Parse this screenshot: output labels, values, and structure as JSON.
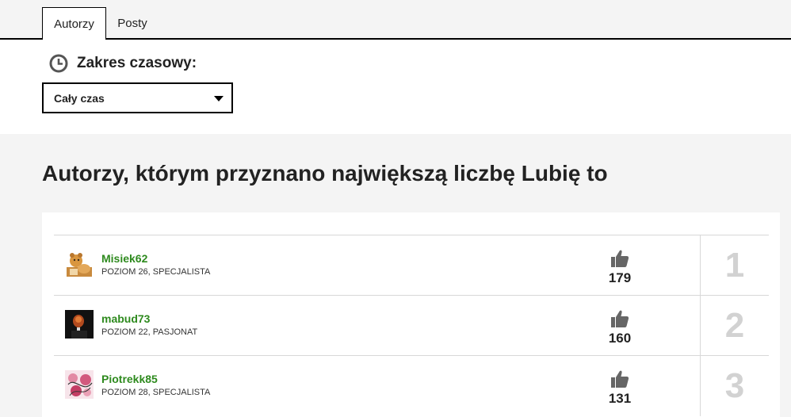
{
  "tabs": [
    {
      "label": "Autorzy",
      "active": true
    },
    {
      "label": "Posty",
      "active": false
    }
  ],
  "time_range": {
    "title": "Zakres czasowy:",
    "selected": "Cały czas",
    "icon": "clock-icon"
  },
  "leaderboard": {
    "heading": "Autorzy, którym przyznano największą liczbę Lubię to",
    "like_icon": "thumbs-up-icon",
    "link_color": "#2e8a1e",
    "entries": [
      {
        "username": "Misiek62",
        "rank": "POZIOM 26, SPECJALISTA",
        "likes": "179",
        "position": "1",
        "avatar": "teddy-bear-avatar"
      },
      {
        "username": "mabud73",
        "rank": "POZIOM 22, PASJONAT",
        "likes": "160",
        "position": "2",
        "avatar": "dark-portrait-avatar"
      },
      {
        "username": "Piotrekk85",
        "rank": "POZIOM 28, SPECJALISTA",
        "likes": "131",
        "position": "3",
        "avatar": "pink-sketch-avatar"
      }
    ]
  }
}
